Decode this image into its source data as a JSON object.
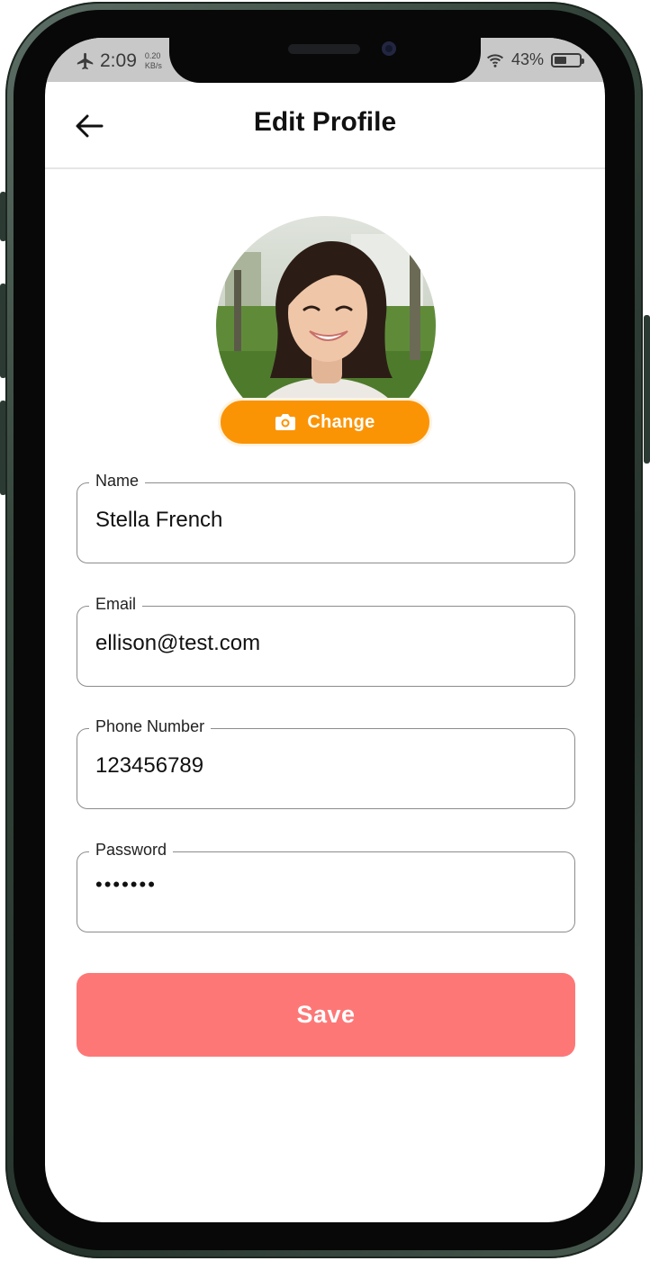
{
  "status_bar": {
    "time": "2:09",
    "speed_value": "0.20",
    "speed_unit": "KB/s",
    "battery_text": "43%",
    "battery_level": 0.43
  },
  "header": {
    "title": "Edit Profile",
    "back_icon": "arrow-left-icon"
  },
  "avatar": {
    "change_label": "Change",
    "change_icon": "camera-icon"
  },
  "form": {
    "name": {
      "label": "Name",
      "value": "Stella French"
    },
    "email": {
      "label": "Email",
      "value": "ellison@test.com"
    },
    "phone": {
      "label": "Phone Number",
      "value": "123456789"
    },
    "password": {
      "label": "Password",
      "value": "•••••••"
    }
  },
  "save_label": "Save",
  "colors": {
    "accent_orange": "#fb9405",
    "save_button": "#fe7777",
    "frame": "#34453c"
  }
}
